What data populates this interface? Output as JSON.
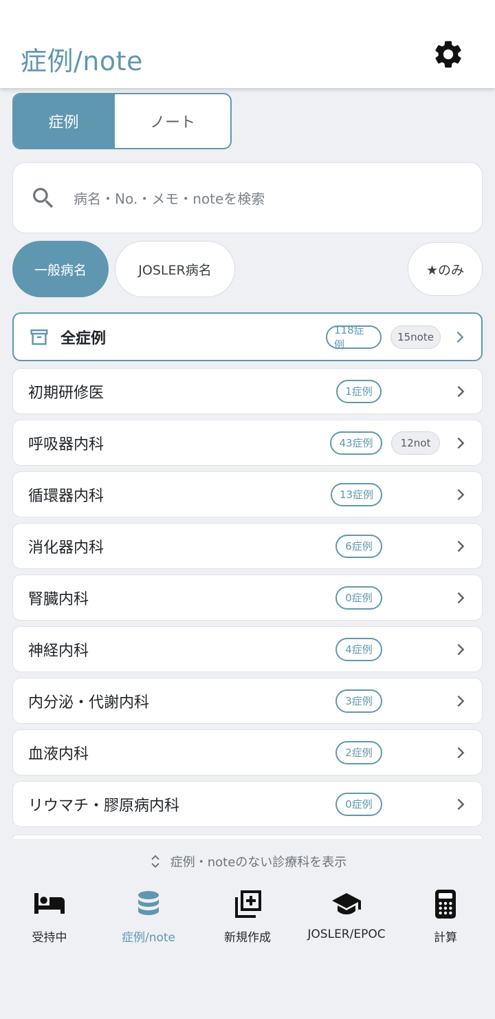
{
  "header": {
    "title": "症例/note",
    "settings_icon": "gear-icon"
  },
  "segment": {
    "active": "症例",
    "inactive": "ノート"
  },
  "search": {
    "placeholder": "病名・No.・メモ・noteを検索"
  },
  "filters": {
    "general": "一般病名",
    "josler": "JOSLER病名",
    "starred": "★のみ"
  },
  "all_cases": {
    "label": "全症例",
    "cases": "118症例",
    "notes": "15note"
  },
  "departments": [
    {
      "label": "初期研修医",
      "cases": "1症例",
      "notes": ""
    },
    {
      "label": "呼吸器内科",
      "cases": "43症例",
      "notes": "12not"
    },
    {
      "label": "循環器内科",
      "cases": "13症例",
      "notes": ""
    },
    {
      "label": "消化器内科",
      "cases": "6症例",
      "notes": ""
    },
    {
      "label": "腎臓内科",
      "cases": "0症例",
      "notes": ""
    },
    {
      "label": "神経内科",
      "cases": "4症例",
      "notes": ""
    },
    {
      "label": "内分泌・代謝内科",
      "cases": "3症例",
      "notes": ""
    },
    {
      "label": "血液内科",
      "cases": "2症例",
      "notes": ""
    },
    {
      "label": "リウマチ・膠原病内科",
      "cases": "0症例",
      "notes": ""
    }
  ],
  "show_empty_toggle": "症例・noteのない診療科を表示",
  "bottom_nav": [
    {
      "label": "受持中",
      "icon": "bed-icon",
      "active": false
    },
    {
      "label": "症例/note",
      "icon": "database-icon",
      "active": true
    },
    {
      "label": "新規作成",
      "icon": "add-box-icon",
      "active": false
    },
    {
      "label": "JOSLER/EPOC",
      "icon": "graduation-cap-icon",
      "active": false
    },
    {
      "label": "計算",
      "icon": "calculator-icon",
      "active": false
    }
  ],
  "colors": {
    "accent": "#5f97b0",
    "background": "#eef0f4",
    "surface": "#ffffff"
  }
}
